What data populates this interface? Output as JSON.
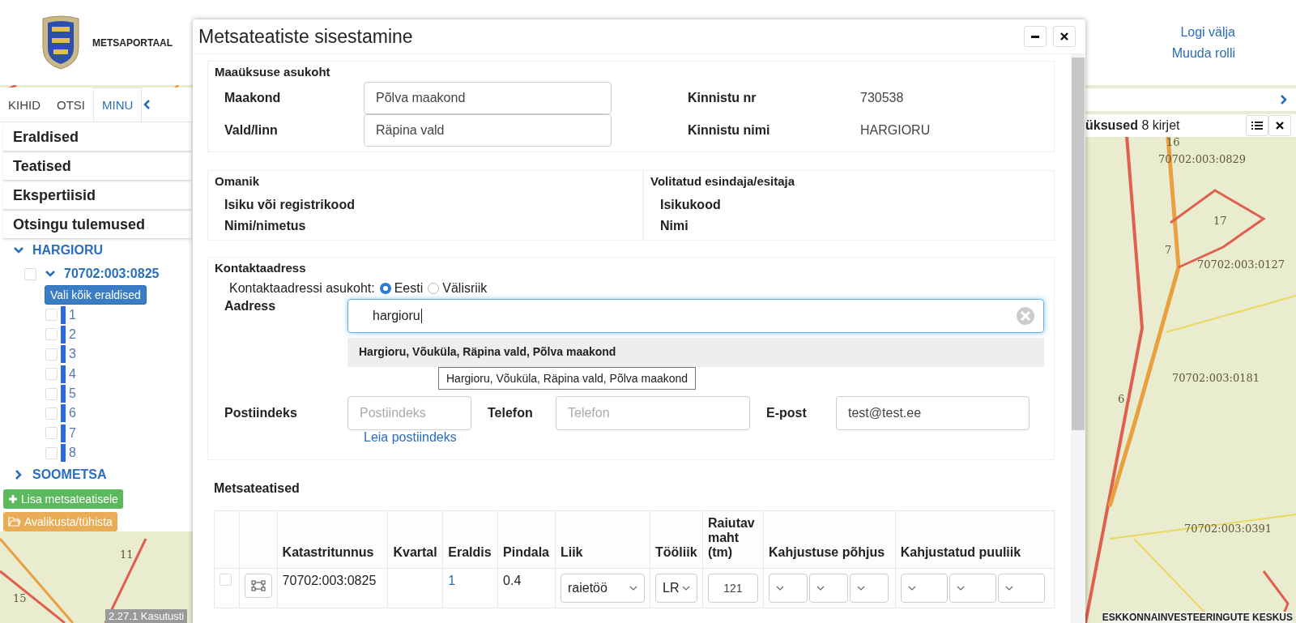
{
  "header": {
    "logo_text": "METSAPORTAAL",
    "links": [
      "Logi välja",
      "Muuda rolli"
    ]
  },
  "sidebar": {
    "tabs": [
      {
        "label": "KIHID",
        "selected": false
      },
      {
        "label": "OTSI",
        "selected": false
      },
      {
        "label": "MINU",
        "selected": true
      }
    ],
    "sections": [
      "Eraldised",
      "Teatised",
      "Ekspertiisid",
      "Otsingu tulemused"
    ],
    "tree": [
      {
        "label": "HARGIORU",
        "expanded": true,
        "children": [
          {
            "label": "70702:003:0825",
            "expanded": true,
            "checked": false,
            "select_all": "Vali kõik eraldised",
            "children": [
              {
                "label": "1",
                "checked": false
              },
              {
                "label": "2",
                "checked": false
              },
              {
                "label": "3",
                "checked": false
              },
              {
                "label": "4",
                "checked": false
              },
              {
                "label": "5",
                "checked": false
              },
              {
                "label": "6",
                "checked": false
              },
              {
                "label": "7",
                "checked": false
              },
              {
                "label": "8",
                "checked": false
              }
            ]
          }
        ]
      },
      {
        "label": "SOOMETSA",
        "expanded": false
      }
    ],
    "buttons": [
      {
        "label": "Lisa metsateatisele",
        "kind": "add"
      },
      {
        "label": "Avalikusta/tühista",
        "kind": "publish"
      }
    ]
  },
  "right_panel": {
    "title": "üksused",
    "count": "8 kirjet"
  },
  "map": {
    "labels": [
      "16",
      "70702:003:0829",
      "17",
      "7",
      "70702:003:0127",
      "70702:003:0181",
      "6",
      "70702:003:0391",
      "11",
      "15"
    ]
  },
  "footer": {
    "left": "2.27.1 Kasutusti",
    "right": "ESKKONNAINVESTEERINGUTE KESKUS"
  },
  "dialog": {
    "title": "Metsateatiste sisestamine",
    "location": {
      "legend": "Maaüksuse asukoht",
      "fields": [
        {
          "label": "Maakond",
          "value": "Põlva maakond"
        },
        {
          "label": "Vald/linn",
          "value": "Räpina vald"
        }
      ],
      "info": [
        {
          "label": "Kinnistu nr",
          "value": "730538"
        },
        {
          "label": "Kinnistu nimi",
          "value": "HARGIORU"
        }
      ]
    },
    "owner": {
      "legend": "Omanik",
      "labels": [
        "Isiku või registrikood",
        "Nimi/nimetus"
      ]
    },
    "representative": {
      "legend": "Volitatud esindaja/esitaja",
      "labels": [
        "Isikukood",
        "Nimi"
      ]
    },
    "contact": {
      "legend": "Kontaktaadress",
      "location_label": "Kontaktaadressi asukoht:",
      "location_options": [
        {
          "label": "Eesti",
          "selected": true
        },
        {
          "label": "Välisriik",
          "selected": false
        }
      ],
      "address_label": "Aadress",
      "address_value": "hargioru",
      "suggestion": "Hargioru, Võuküla, Räpina vald, Põlva maakond",
      "tooltip": "Hargioru, Võuküla, Räpina vald, Põlva maakond",
      "fields": [
        {
          "label": "Postiindeks",
          "placeholder": "Postiindeks"
        },
        {
          "label": "Telefon",
          "placeholder": "Telefon"
        },
        {
          "label": "E-post",
          "value": "test@test.ee"
        }
      ],
      "postcode_link": "Leia postiindeks"
    },
    "notices": {
      "title": "Metsateatised",
      "columns": [
        "Katastritunnus",
        "Kvartal",
        "Eraldis",
        "Pindala",
        "Liik",
        "Tööliik",
        "Raiutav maht (tm)",
        "Kahjustuse põhjus",
        "Kahjustatud puuliik"
      ],
      "rows": [
        {
          "checked": false,
          "cadastre": "70702:003:0825",
          "stand": "1",
          "area": "0.4",
          "type": "raietöö",
          "work_type": "LR",
          "volume": "121"
        }
      ]
    }
  }
}
